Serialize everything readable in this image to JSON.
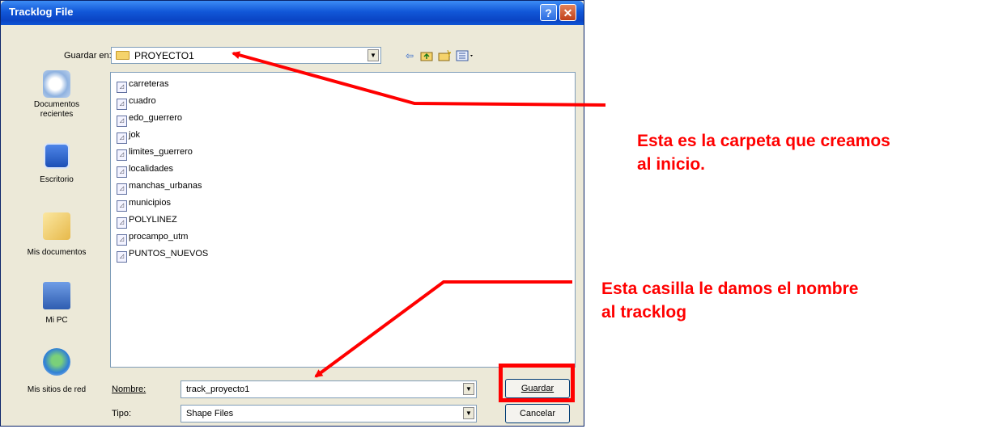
{
  "dialog": {
    "title": "Tracklog File",
    "help_glyph": "?",
    "close_glyph": "✕",
    "save_in_label": "Guardar en:",
    "save_in_value": "PROYECTO1",
    "toolbar_icons": [
      "back-arrow-icon",
      "up-folder-icon",
      "new-folder-icon",
      "view-menu-icon"
    ],
    "places": [
      {
        "label_line1": "Documentos",
        "label_line2": "recientes",
        "icon": "recent-documents-icon"
      },
      {
        "label_line1": "Escritorio",
        "label_line2": "",
        "icon": "desktop-icon"
      },
      {
        "label_line1": "Mis documentos",
        "label_line2": "",
        "icon": "my-documents-icon"
      },
      {
        "label_line1": "Mi PC",
        "label_line2": "",
        "icon": "my-computer-icon"
      },
      {
        "label_line1": "Mis sitios de red",
        "label_line2": "",
        "icon": "network-places-icon"
      }
    ],
    "files": [
      "carreteras",
      "cuadro",
      "edo_guerrero",
      "jok",
      "limites_guerrero",
      "localidades",
      "manchas_urbanas",
      "municipios",
      "POLYLINEZ",
      "procampo_utm",
      "PUNTOS_NUEVOS"
    ],
    "name_label": "Nombre:",
    "name_value": "track_proyecto1",
    "type_label": "Tipo:",
    "type_value": "Shape Files",
    "save_button": "Guardar",
    "cancel_button": "Cancelar"
  },
  "annotations": {
    "folder_note_line1": "Esta es la carpeta que creamos",
    "folder_note_line2": "al inicio.",
    "name_note_line1": "Esta casilla le damos el nombre",
    "name_note_line2": "al tracklog"
  },
  "colors": {
    "annotation": "#ff0000",
    "titlebar": "#0a44c4",
    "dialog_bg": "#ece9d8"
  }
}
